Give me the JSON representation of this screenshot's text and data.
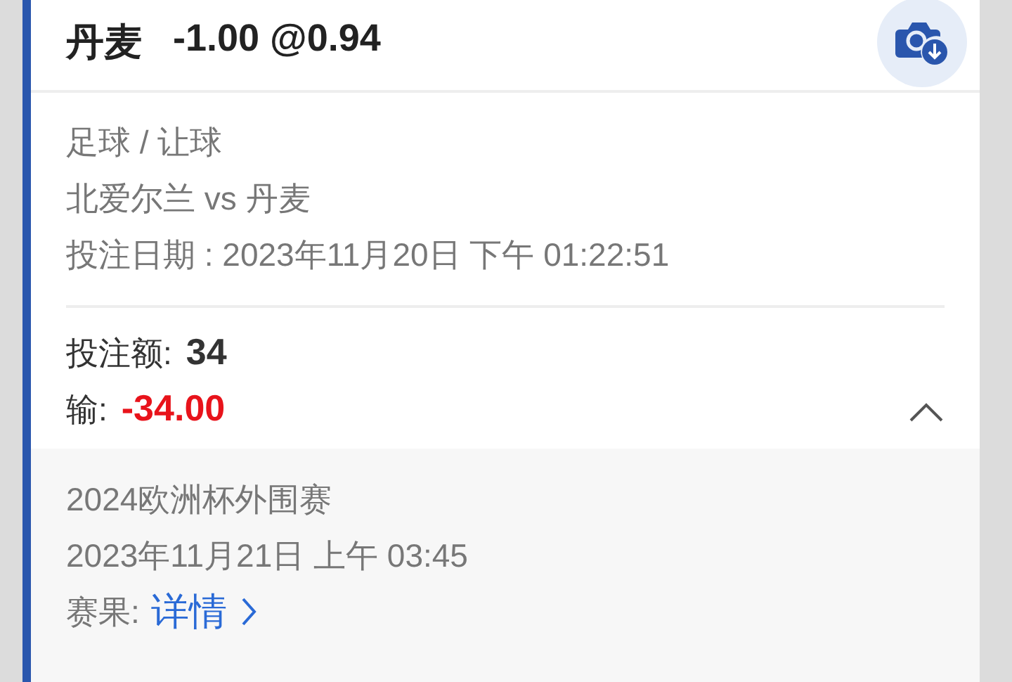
{
  "header": {
    "team": "丹麦",
    "odds": "-1.00 @0.94"
  },
  "details": [
    "足球 / 让球",
    "北爱尔兰 vs 丹麦",
    "投注日期 : 2023年11月20日 下午 01:22:51"
  ],
  "stake": {
    "label": "投注额:",
    "value": "34"
  },
  "result": {
    "label": "输:",
    "value": "-34.00"
  },
  "expanded": true,
  "extra": {
    "competition": "2024欧洲杯外围赛",
    "match_time": "2023年11月21日 上午 03:45",
    "outcome_label": "赛果:",
    "outcome_link": "详情"
  }
}
